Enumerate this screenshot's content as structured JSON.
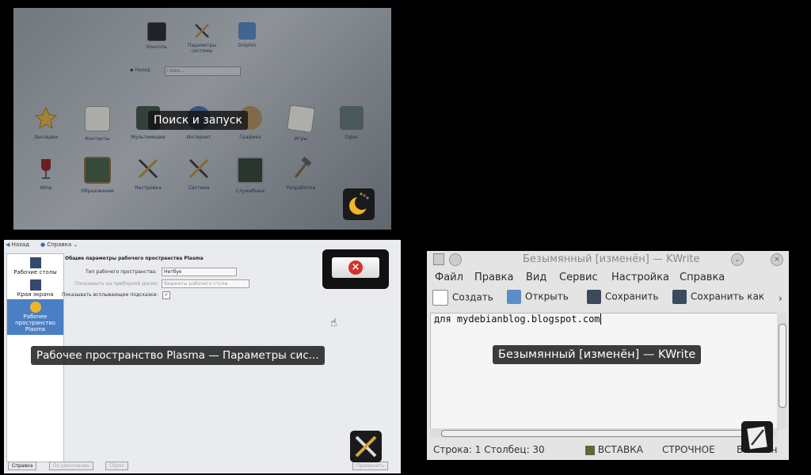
{
  "launcher": {
    "favorites": [
      {
        "label": "Консоль",
        "icon": "terminal-icon"
      },
      {
        "label": "Параметры системы",
        "icon": "settings-tools-icon"
      },
      {
        "label": "Dolphin",
        "icon": "dolphin-file-manager-icon"
      }
    ],
    "back_label": "Назад",
    "search_placeholder": "Поиск...",
    "categories": [
      {
        "label": "Закладки",
        "icon": "star-icon"
      },
      {
        "label": "Контакты",
        "icon": "contacts-icon"
      },
      {
        "label": "Мультимедиа",
        "icon": "multimedia-icon"
      },
      {
        "label": "Интернет",
        "icon": "internet-icon"
      },
      {
        "label": "Графика",
        "icon": "graphics-icon"
      },
      {
        "label": "Игры",
        "icon": "games-cards-icon"
      },
      {
        "label": "Офис",
        "icon": "typewriter-office-icon"
      },
      {
        "label": "Wine",
        "icon": "wine-glass-icon"
      },
      {
        "label": "Образование",
        "icon": "education-board-icon"
      },
      {
        "label": "Настройка",
        "icon": "settings-tools-icon"
      },
      {
        "label": "Система",
        "icon": "system-tools-icon"
      },
      {
        "label": "Служебные",
        "icon": "utilities-icon"
      },
      {
        "label": "Разработка",
        "icon": "development-hammer-icon"
      }
    ],
    "window_title": "Поиск и запуск"
  },
  "settings": {
    "toolbar": {
      "back": "Назад",
      "help": "Справка"
    },
    "sidebar": [
      {
        "label": "Рабочие столы",
        "icon": "desktops-icon"
      },
      {
        "label": "Края экрана",
        "icon": "screen-edges-icon"
      },
      {
        "label": "Рабочее пространство Plasma",
        "icon": "plasma-workspace-icon",
        "selected": true
      }
    ],
    "heading": "Общие параметры рабочего пространства Plasma",
    "fields": [
      {
        "label": "Тип рабочего пространства:",
        "value": "Нетбук"
      },
      {
        "label": "Показывать на приборной доске:",
        "value": "Виджеты рабочего стола"
      },
      {
        "label": "Показывать всплывающие подсказки:",
        "value": "✓"
      }
    ],
    "buttons": {
      "help": "Справка",
      "defaults": "По умолчанию",
      "reset": "Сброс",
      "apply": "Применить"
    },
    "window_title": "Рабочее пространство Plasma — Параметры сис..."
  },
  "kwrite": {
    "title": "Безымянный [изменён] — KWrite",
    "menu": [
      "Файл",
      "Правка",
      "Вид",
      "Сервис",
      "Настройка",
      "Справка"
    ],
    "toolbar": [
      {
        "label": "Создать",
        "icon": "new-document-icon"
      },
      {
        "label": "Открыть",
        "icon": "open-folder-icon"
      },
      {
        "label": "Сохранить",
        "icon": "save-icon"
      },
      {
        "label": "Сохранить как",
        "icon": "save-as-icon"
      }
    ],
    "text": "для mydebianblog.blogspot.com",
    "status": {
      "position": "Строка: 1 Столбец: 30",
      "mode": "ВСТАВКА",
      "line_mode": "СТРОЧНОЕ",
      "encoding": "Восточн"
    },
    "overlay_title": "Безымянный [изменён] — KWrite"
  }
}
